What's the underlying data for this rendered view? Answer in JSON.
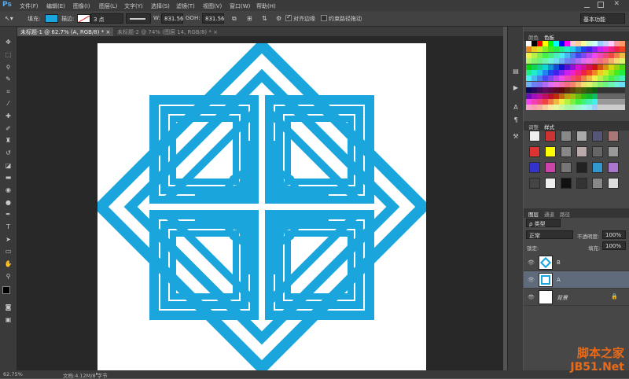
{
  "app": {
    "logo": "Ps"
  },
  "menu": [
    "文件(F)",
    "编辑(E)",
    "图像(I)",
    "图层(L)",
    "文字(Y)",
    "选择(S)",
    "滤镜(T)",
    "视图(V)",
    "窗口(W)",
    "帮助(H)"
  ],
  "workspace": "基本功能",
  "options": {
    "fill_label": "填充:",
    "stroke_label": "描边:",
    "stroke_size": "3 点",
    "w_label": "W:",
    "w_value": "831.56",
    "link_symbol": "GO",
    "h_label": "H:",
    "h_value": "831.56",
    "align_edges": "对齐边缘",
    "constrain_path": "约束路径拖动",
    "fill_color": "#1aa5dc"
  },
  "tabs": [
    {
      "label": "未标题-1 @ 62.7% (A, RGB/8) *",
      "close": "×"
    },
    {
      "label": "未标题-2 @ 74% (图层 14, RGB/8) *",
      "close": "×"
    }
  ],
  "status": {
    "zoom": "62.75%",
    "doc": "文档:4.12M/8 字节"
  },
  "panels": {
    "color_tabs": [
      "颜色",
      "色板"
    ],
    "adjust_tabs": [
      "调整",
      "样式"
    ],
    "layer_tabs": [
      "图层",
      "通道",
      "路径"
    ],
    "kind": "ρ 类型",
    "blend_mode": "正常",
    "opacity_label": "不透明度:",
    "opacity_value": "100%",
    "lock_label": "锁定:",
    "fill_label": "填充:",
    "fill_value": "100%",
    "layers": [
      {
        "name": "B",
        "selected": false
      },
      {
        "name": "A",
        "selected": true
      },
      {
        "name": "背景",
        "selected": false,
        "locked": true
      }
    ]
  },
  "watermark": {
    "line1": "脚本之家",
    "line2": "JB51.Net"
  },
  "colors": {
    "shape": "#1aa5dc",
    "accent": "#4a90d9"
  }
}
